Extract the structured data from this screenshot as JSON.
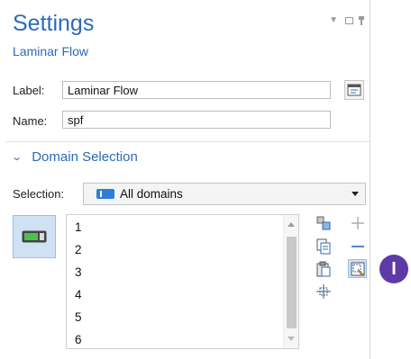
{
  "header": {
    "title": "Settings",
    "subtitle": "Laminar Flow"
  },
  "fields": {
    "label_caption": "Label:",
    "label_value": "Laminar Flow",
    "name_caption": "Name:",
    "name_value": "spf"
  },
  "domain_selection": {
    "section_title": "Domain Selection",
    "selection_caption": "Selection:",
    "selected_option": "All domains",
    "items": [
      "1",
      "2",
      "3",
      "4",
      "5",
      "6"
    ]
  },
  "step_badge": {
    "text": "I"
  },
  "colors": {
    "accent": "#2d6bb5",
    "badge": "#5d3aa8",
    "selection_icon": "#2b7fd6"
  },
  "icons": [
    "collapse-icon",
    "restore-icon",
    "pin-icon",
    "label-edit-icon",
    "chevron-down-icon",
    "domain-toggle-icon",
    "paste-selection-icon",
    "copy-selection-icon",
    "clear-selection-icon",
    "zoom-selection-icon",
    "add-icon",
    "remove-icon",
    "create-selection-icon"
  ]
}
